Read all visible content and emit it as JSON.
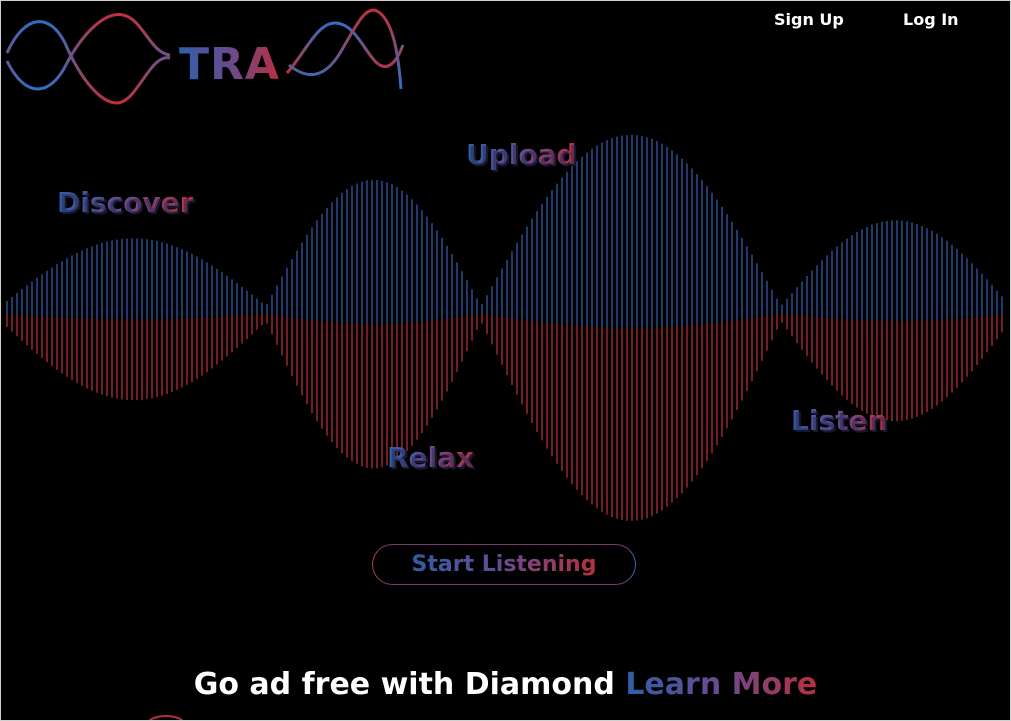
{
  "brand": {
    "logo_text": "TRA",
    "colors": {
      "blue": "#2f5fa8",
      "purple": "#6a4a8e",
      "red": "#b8303f"
    }
  },
  "nav": {
    "signup_label": "Sign Up",
    "login_label": "Log In"
  },
  "hero": {
    "words": {
      "discover": "Discover",
      "upload": "Upload",
      "relax": "Relax",
      "listen": "Listen"
    },
    "cta_label": "Start Listening"
  },
  "promo": {
    "text": "Go ad free with Diamond",
    "link_label": "Learn More"
  },
  "background": "#000000"
}
